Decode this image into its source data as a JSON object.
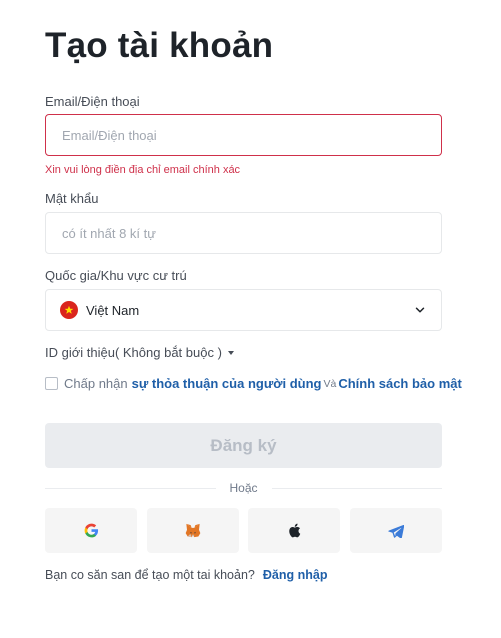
{
  "page": {
    "title": "Tạo tài khoản"
  },
  "email": {
    "label": "Email/Điện thoại",
    "placeholder": "Email/Điện thoại",
    "value": "",
    "error": "Xin vui lòng điền địa chỉ email chính xác"
  },
  "password": {
    "label": "Mật khẩu",
    "placeholder": "có ít nhất 8 kí tự",
    "value": ""
  },
  "country": {
    "label": "Quốc gia/Khu vực cư trú",
    "selected": "Việt Nam",
    "flag_icon": "vietnam-flag-icon"
  },
  "referral": {
    "label": "ID giới thiệu( Không bắt buộc )"
  },
  "terms": {
    "prefix": "Chấp nhận",
    "link1": "sự thỏa thuận của người dùng",
    "conjunction": "Và",
    "link2": "Chính sách bảo mật"
  },
  "signup_button": {
    "label": "Đăng ký"
  },
  "divider": {
    "label": "Hoặc"
  },
  "social": [
    {
      "icon": "google-icon"
    },
    {
      "icon": "metamask-icon"
    },
    {
      "icon": "apple-icon"
    },
    {
      "icon": "telegram-icon"
    }
  ],
  "footer": {
    "prompt": "Bạn co săn san để tạo một tai khoản?",
    "login_link": "Đăng nhập"
  },
  "colors": {
    "error": "#cf304a",
    "link": "#1f5fa8",
    "disabled_bg": "#eaecef",
    "disabled_text": "#b7bdc6"
  }
}
